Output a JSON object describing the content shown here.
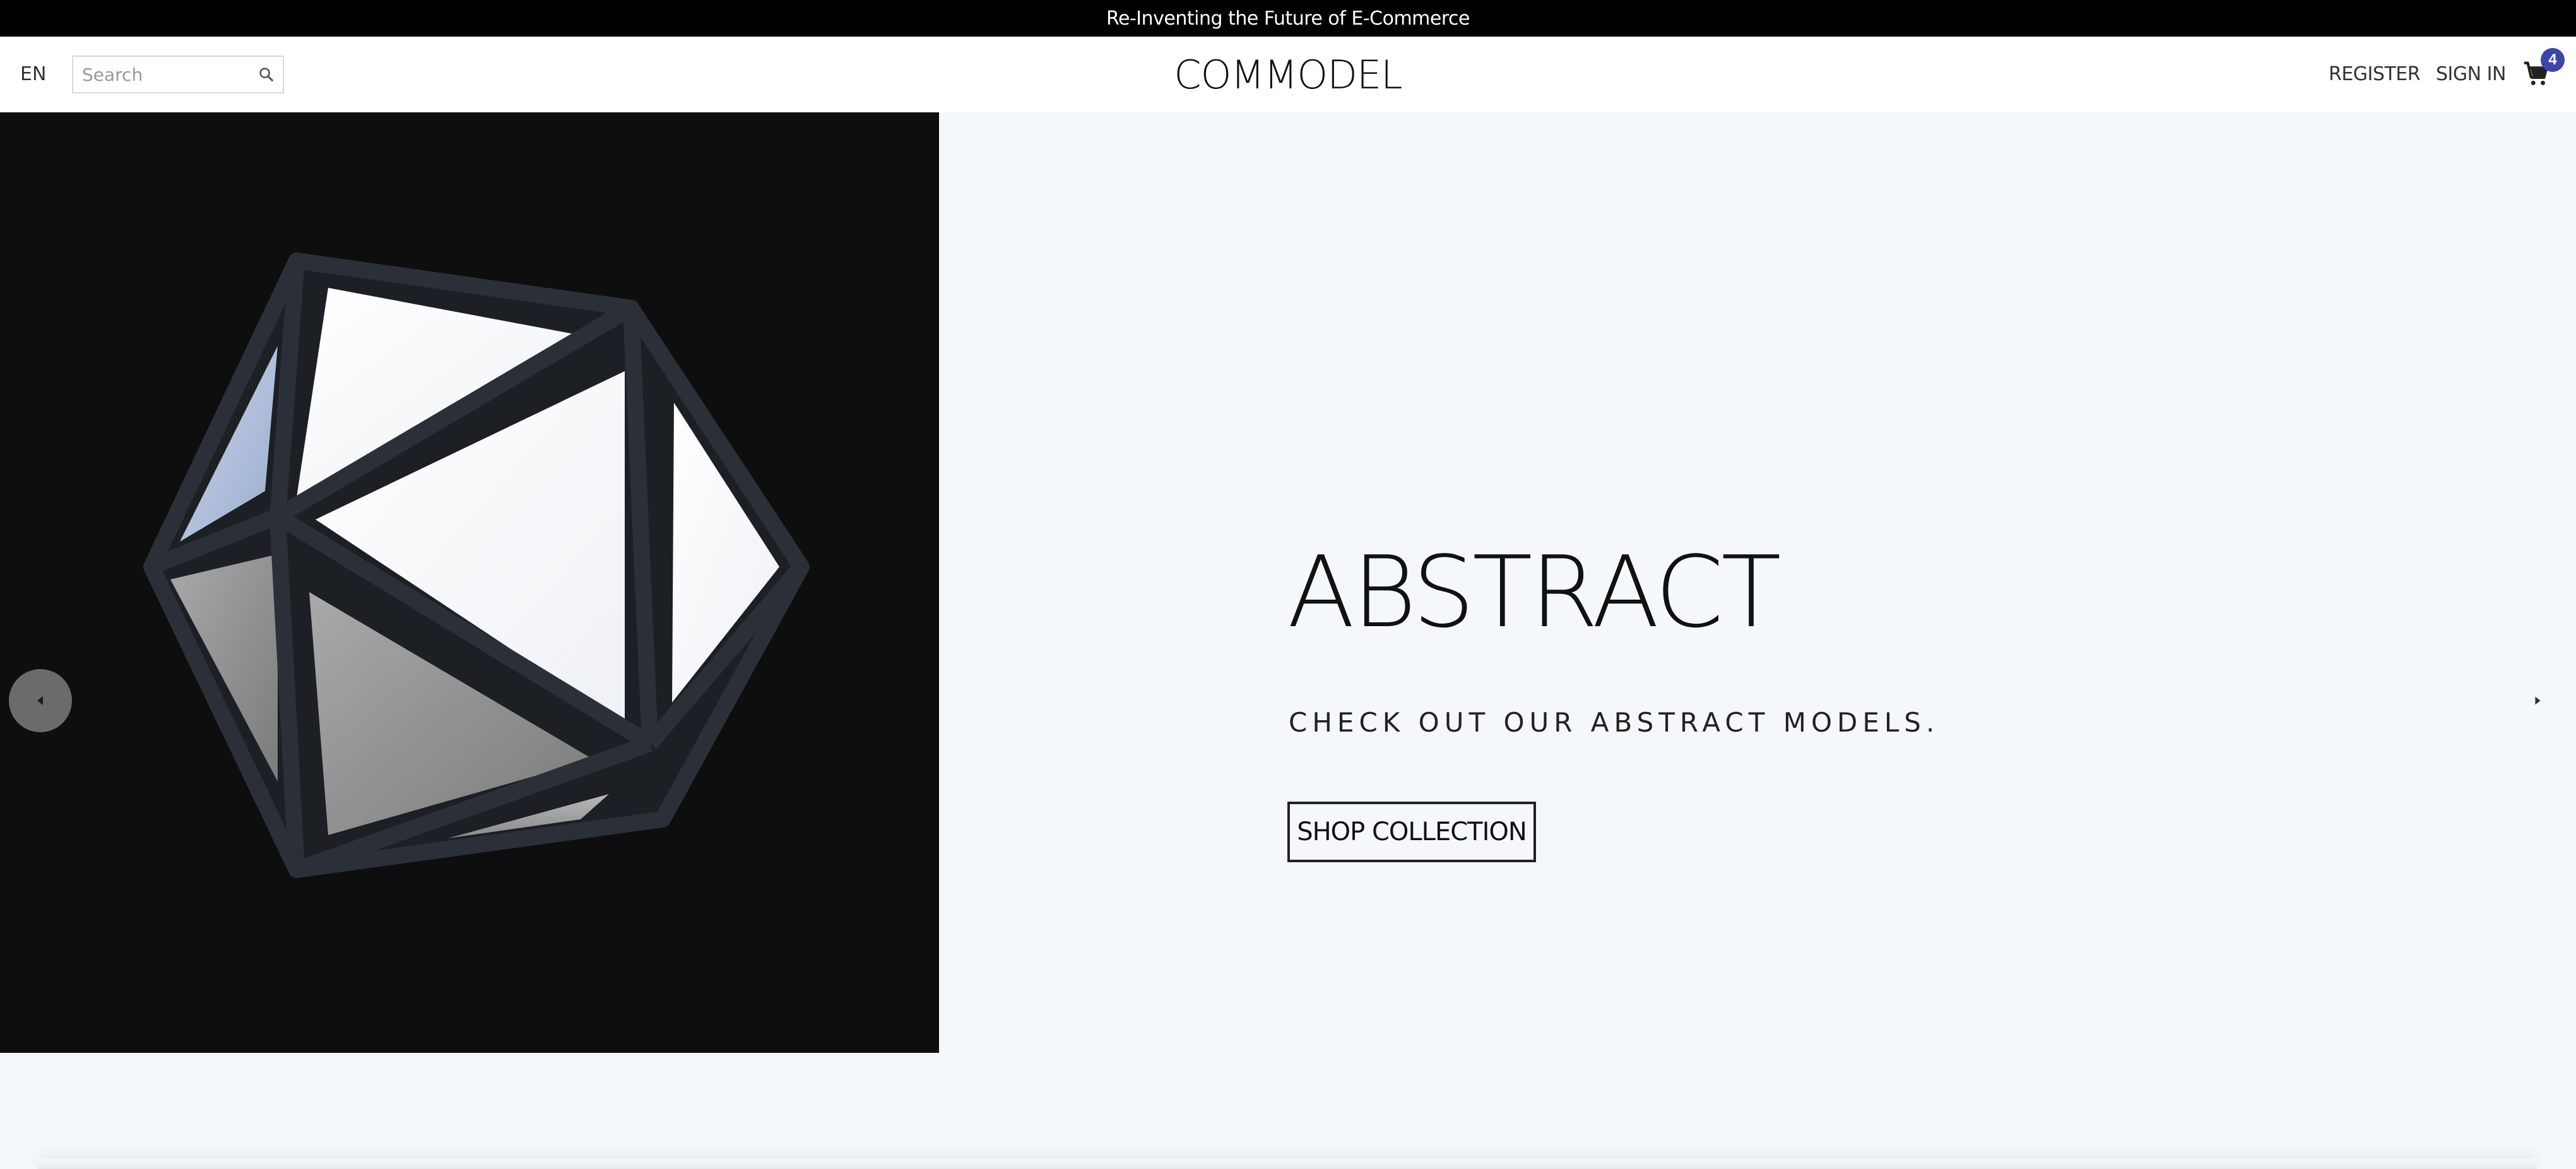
{
  "announcement": {
    "text": "Re-Inventing the Future of E-Commerce"
  },
  "header": {
    "language": "EN",
    "search": {
      "placeholder": "Search",
      "value": ""
    },
    "logo": "COMMODEL",
    "register_label": "REGISTER",
    "signin_label": "SIGN IN",
    "cart_count": "4"
  },
  "hero": {
    "title": "ABSTRACT",
    "subtitle": "CHECK OUT OUR ABSTRACT MODELS.",
    "cta_label": "SHOP COLLECTION",
    "image_subject": "icosahedron-wireframe"
  },
  "colors": {
    "announcement_bg": "#000000",
    "hero_bg": "#f4f8fb",
    "image_bg": "#0e0e0e",
    "badge": "#3c45a8"
  }
}
